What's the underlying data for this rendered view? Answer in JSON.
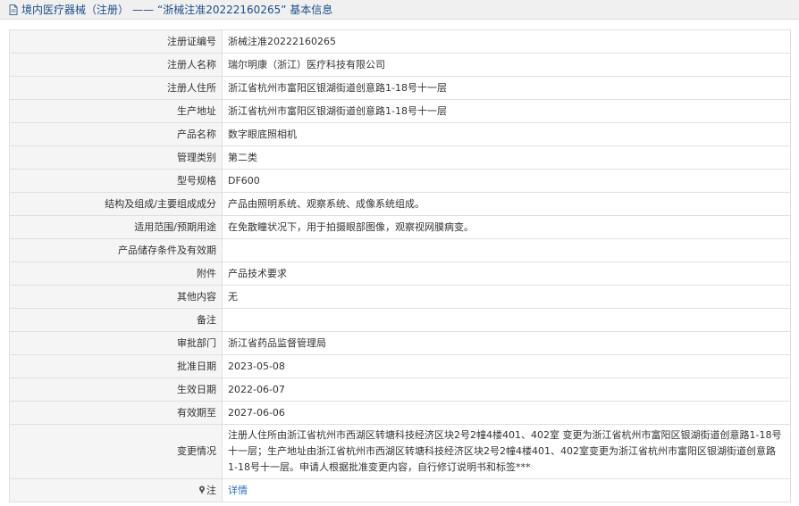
{
  "header": {
    "category": "境内医疗器械（注册）",
    "dash": "——",
    "title": "“浙械注准20222160265” 基本信息"
  },
  "rows": [
    {
      "label": "注册证编号",
      "value": "浙械注准20222160265"
    },
    {
      "label": "注册人名称",
      "value": "瑞尔明康（浙江）医疗科技有限公司"
    },
    {
      "label": "注册人住所",
      "value": "浙江省杭州市富阳区银湖街道创意路1-18号十一层"
    },
    {
      "label": "生产地址",
      "value": "浙江省杭州市富阳区银湖街道创意路1-18号十一层"
    },
    {
      "label": "产品名称",
      "value": "数字眼底照相机"
    },
    {
      "label": "管理类别",
      "value": "第二类"
    },
    {
      "label": "型号规格",
      "value": "DF600"
    },
    {
      "label": "结构及组成/主要组成成分",
      "value": "产品由照明系统、观察系统、成像系统组成。"
    },
    {
      "label": "适用范围/预期用途",
      "value": "在免散瞳状况下，用于拍摄眼部图像，观察视网膜病变。"
    },
    {
      "label": "产品储存条件及有效期",
      "value": ""
    },
    {
      "label": "附件",
      "value": "产品技术要求"
    },
    {
      "label": "其他内容",
      "value": "无"
    },
    {
      "label": "备注",
      "value": ""
    },
    {
      "label": "审批部门",
      "value": "浙江省药品监督管理局"
    },
    {
      "label": "批准日期",
      "value": "2023-05-08"
    },
    {
      "label": "生效日期",
      "value": "2022-06-07"
    },
    {
      "label": "有效期至",
      "value": "2027-06-06"
    },
    {
      "label": "变更情况",
      "value": "注册人住所由浙江省杭州市西湖区转塘科技经济区块2号2幢4楼401、402室 变更为浙江省杭州市富阳区银湖街道创意路1-18号十一层；生产地址由浙江省杭州市西湖区转塘科技经济区块2号2幢4楼401、402室变更为浙江省杭州市富阳区银湖街道创意路1-18号十一层。申请人根据批准变更内容，自行修订说明书和标签***"
    }
  ],
  "note": {
    "label": "注",
    "icon": "pin-icon",
    "link": "详情"
  },
  "colors": {
    "link": "#2a6ec6",
    "header_text": "#1a4f8a",
    "label_bg": "#f5f5f5",
    "border": "#e0e0e0"
  }
}
